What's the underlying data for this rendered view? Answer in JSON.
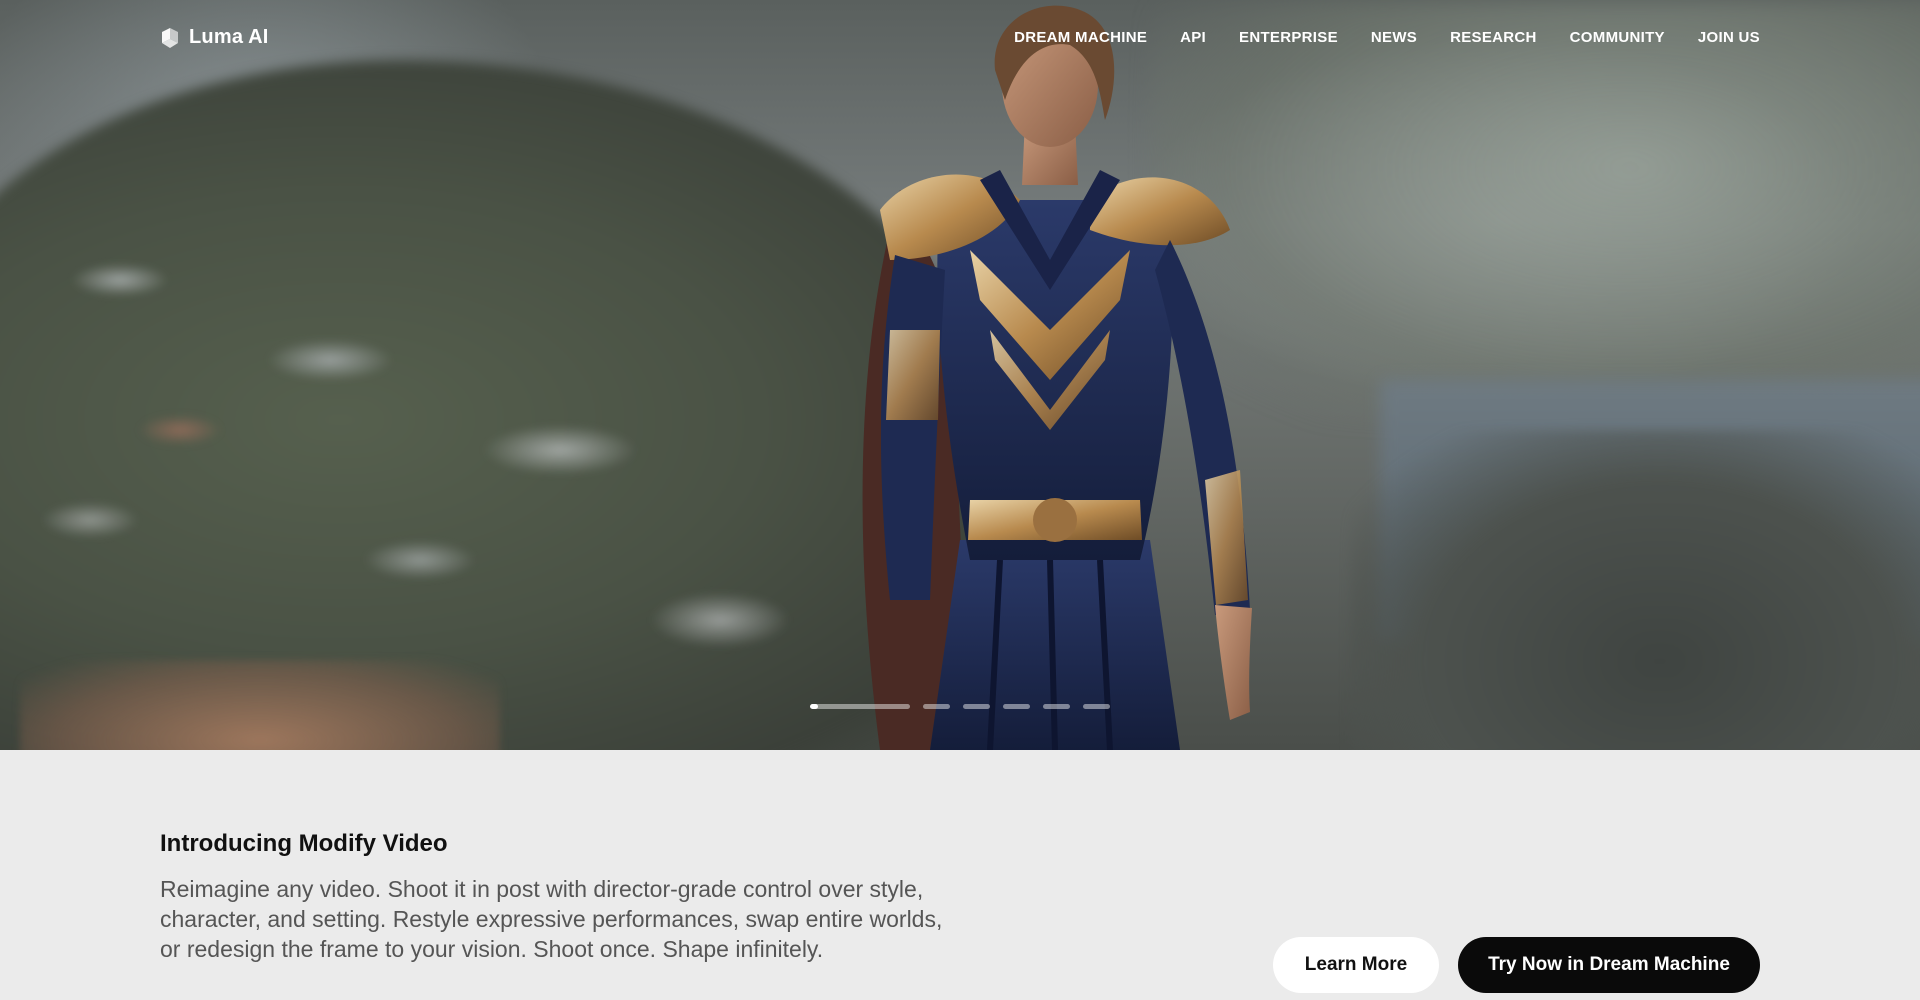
{
  "brand": {
    "name": "Luma AI",
    "logo_icon": "luma-logo-icon"
  },
  "nav": {
    "links": [
      "DREAM MACHINE",
      "API",
      "ENTERPRISE",
      "NEWS",
      "RESEARCH",
      "COMMUNITY",
      "JOIN US"
    ]
  },
  "hero": {
    "carousel": {
      "slide_count": 6,
      "active_index": 0,
      "active_progress": 0.08
    }
  },
  "feature": {
    "title": "Introducing Modify Video",
    "description": "Reimagine any video. Shoot it in post with director-grade control over style, character, and setting. Restyle expressive performances, swap entire worlds, or redesign the frame to your vision. Shoot once. Shape infinitely.",
    "learn_more_label": "Learn More",
    "try_now_label": "Try Now in Dream Machine"
  },
  "colors": {
    "page_bg": "#ebebeb",
    "primary_button": "#0a0a0a",
    "secondary_button": "#ffffff"
  }
}
